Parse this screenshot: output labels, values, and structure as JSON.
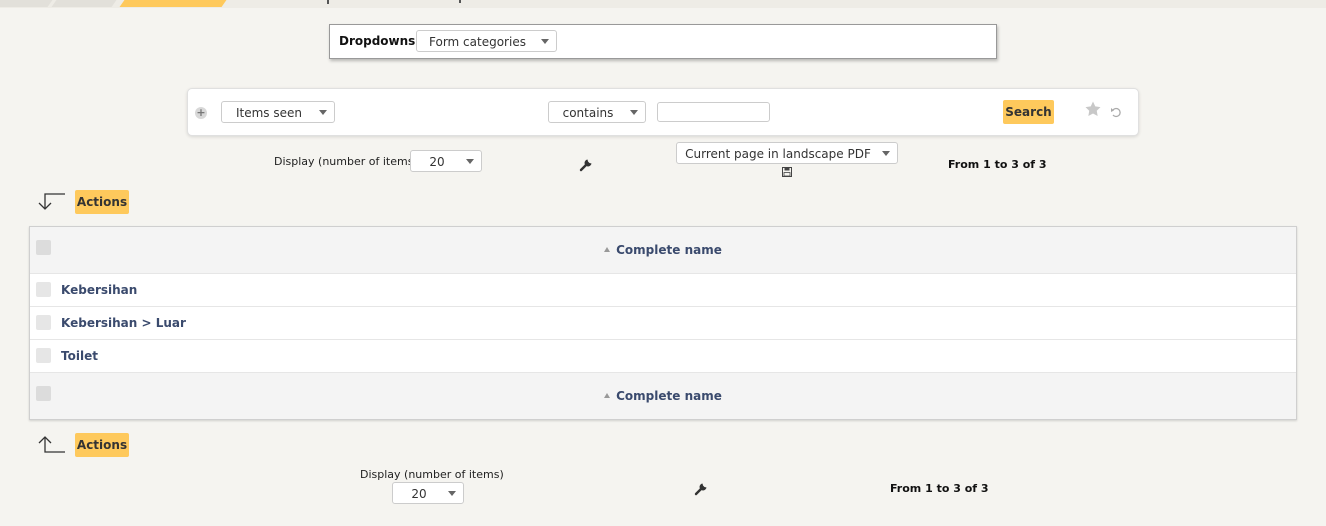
{
  "header": {
    "dropdowns_label": "Dropdowns",
    "dropdowns_value": "Form categories"
  },
  "search": {
    "field_select": "Items seen",
    "operator_select": "contains",
    "value": "",
    "search_label": "Search"
  },
  "pager_top": {
    "display_label": "Display (number of items)",
    "display_value": "20",
    "export_select": "Current page in landscape PDF",
    "range_text": "From 1 to 3 of 3"
  },
  "actions_label": "Actions",
  "table": {
    "column_header": "Complete name",
    "rows": [
      "Kebersihan",
      "Kebersihan > Luar",
      "Toilet"
    ]
  },
  "pager_bottom": {
    "display_label": "Display (number of items)",
    "display_value": "20",
    "range_text": "From 1 to 3 of 3"
  },
  "colors": {
    "accent": "#fec95c",
    "link": "#3a4a6d",
    "background": "#f5f4f0"
  },
  "icons": [
    "plus-icon",
    "star-icon",
    "reset-icon",
    "wrench-icon",
    "save-icon",
    "arrow-down-icon",
    "arrow-up-icon"
  ]
}
